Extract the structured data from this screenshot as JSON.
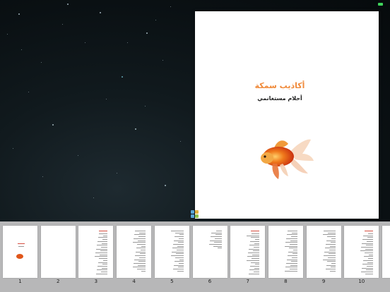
{
  "book": {
    "title": "أكاذيب سمكة",
    "author": "أحلام مستغانمي"
  },
  "colors": {
    "title": "#f08a3a",
    "background": "#0b1114",
    "strip": "#b7b7b8",
    "battery": "#3fd35b"
  },
  "icons": {
    "grid": "grid-view-icon",
    "cover_art": "goldfish-illustration"
  },
  "thumbnails": [
    {
      "number": "1",
      "content": "cover"
    },
    {
      "number": "2",
      "content": "blank"
    },
    {
      "number": "3",
      "content": "text-red-heading"
    },
    {
      "number": "4",
      "content": "text"
    },
    {
      "number": "5",
      "content": "text"
    },
    {
      "number": "6",
      "content": "text-sparse"
    },
    {
      "number": "7",
      "content": "text-red-heading"
    },
    {
      "number": "8",
      "content": "text"
    },
    {
      "number": "9",
      "content": "text"
    },
    {
      "number": "10",
      "content": "text-red-heading"
    },
    {
      "number": "",
      "content": "text"
    }
  ]
}
